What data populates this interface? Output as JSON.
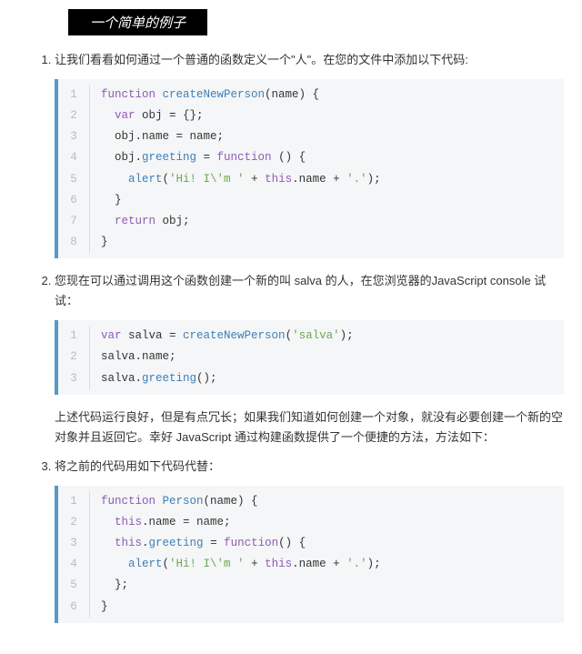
{
  "header": "一个简单的例子",
  "items": {
    "i1": "让我们看看如何通过一个普通的函数定义一个\"人\"。在您的文件中添加以下代码:",
    "i2": "您现在可以通过调用这个函数创建一个新的叫 salva 的人，在您浏览器的JavaScript console 试试：",
    "para": "上述代码运行良好，但是有点冗长；如果我们知道如何创建一个对象，就没有必要创建一个新的空对象并且返回它。幸好 JavaScript 通过构建函数提供了一个便捷的方法，方法如下：",
    "i3": "将之前的代码用如下代码代替："
  },
  "code1": {
    "l1": [
      {
        "t": "function ",
        "c": "kw"
      },
      {
        "t": "createNewPerson",
        "c": "fn"
      },
      {
        "t": "(name) {",
        "c": "op"
      }
    ],
    "l2": [
      {
        "t": "  ",
        "c": "op"
      },
      {
        "t": "var",
        "c": "kw"
      },
      {
        "t": " obj = {};",
        "c": "op"
      }
    ],
    "l3": [
      {
        "t": "  obj.name = name;",
        "c": "op"
      }
    ],
    "l4": [
      {
        "t": "  obj.",
        "c": "op"
      },
      {
        "t": "greeting",
        "c": "fn"
      },
      {
        "t": " = ",
        "c": "op"
      },
      {
        "t": "function",
        "c": "kw"
      },
      {
        "t": " () {",
        "c": "op"
      }
    ],
    "l5": [
      {
        "t": "    ",
        "c": "op"
      },
      {
        "t": "alert",
        "c": "fn"
      },
      {
        "t": "(",
        "c": "op"
      },
      {
        "t": "'Hi! I\\'m '",
        "c": "str"
      },
      {
        "t": " + ",
        "c": "op"
      },
      {
        "t": "this",
        "c": "kw"
      },
      {
        "t": ".name + ",
        "c": "op"
      },
      {
        "t": "'.'",
        "c": "str"
      },
      {
        "t": ");",
        "c": "op"
      }
    ],
    "l6": [
      {
        "t": "  }",
        "c": "op"
      }
    ],
    "l7": [
      {
        "t": "  ",
        "c": "op"
      },
      {
        "t": "return",
        "c": "kw"
      },
      {
        "t": " obj;",
        "c": "op"
      }
    ],
    "l8": [
      {
        "t": "}",
        "c": "op"
      }
    ]
  },
  "code2": {
    "l1": [
      {
        "t": "var",
        "c": "kw"
      },
      {
        "t": " salva = ",
        "c": "op"
      },
      {
        "t": "createNewPerson",
        "c": "fn"
      },
      {
        "t": "(",
        "c": "op"
      },
      {
        "t": "'salva'",
        "c": "str"
      },
      {
        "t": ");",
        "c": "op"
      }
    ],
    "l2": [
      {
        "t": "salva.name;",
        "c": "op"
      }
    ],
    "l3": [
      {
        "t": "salva.",
        "c": "op"
      },
      {
        "t": "greeting",
        "c": "fn"
      },
      {
        "t": "();",
        "c": "op"
      }
    ]
  },
  "code3": {
    "l1": [
      {
        "t": "function ",
        "c": "kw"
      },
      {
        "t": "Person",
        "c": "fn"
      },
      {
        "t": "(name) {",
        "c": "op"
      }
    ],
    "l2": [
      {
        "t": "  ",
        "c": "op"
      },
      {
        "t": "this",
        "c": "kw"
      },
      {
        "t": ".name = name;",
        "c": "op"
      }
    ],
    "l3": [
      {
        "t": "  ",
        "c": "op"
      },
      {
        "t": "this",
        "c": "kw"
      },
      {
        "t": ".",
        "c": "op"
      },
      {
        "t": "greeting",
        "c": "fn"
      },
      {
        "t": " = ",
        "c": "op"
      },
      {
        "t": "function",
        "c": "kw"
      },
      {
        "t": "() {",
        "c": "op"
      }
    ],
    "l4": [
      {
        "t": "    ",
        "c": "op"
      },
      {
        "t": "alert",
        "c": "fn"
      },
      {
        "t": "(",
        "c": "op"
      },
      {
        "t": "'Hi! I\\'m '",
        "c": "str"
      },
      {
        "t": " + ",
        "c": "op"
      },
      {
        "t": "this",
        "c": "kw"
      },
      {
        "t": ".name + ",
        "c": "op"
      },
      {
        "t": "'.'",
        "c": "str"
      },
      {
        "t": ");",
        "c": "op"
      }
    ],
    "l5": [
      {
        "t": "  };",
        "c": "op"
      }
    ],
    "l6": [
      {
        "t": "}",
        "c": "op"
      }
    ]
  },
  "linenos": {
    "n1": "1",
    "n2": "2",
    "n3": "3",
    "n4": "4",
    "n5": "5",
    "n6": "6",
    "n7": "7",
    "n8": "8"
  }
}
